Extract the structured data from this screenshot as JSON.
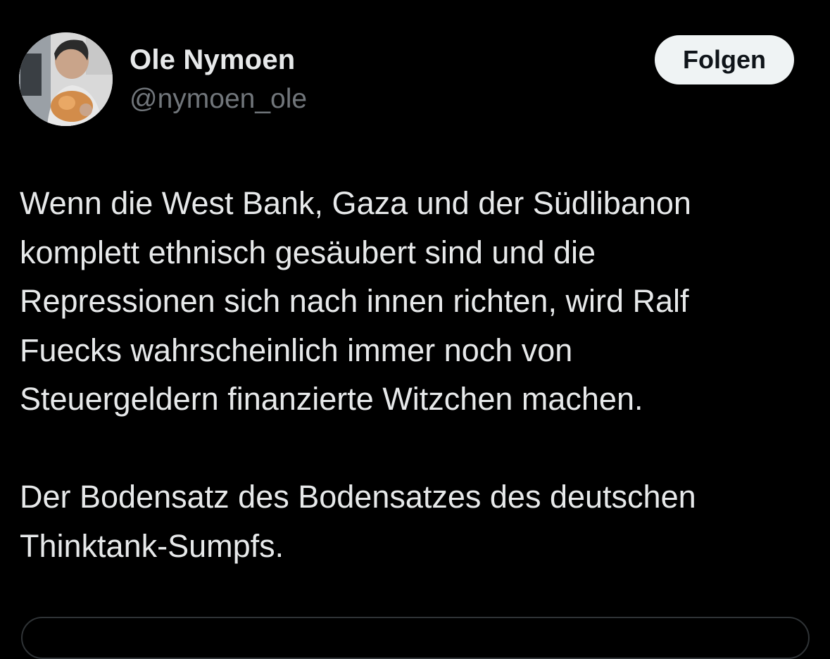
{
  "author": {
    "display_name": "Ole Nymoen",
    "handle": "@nymoen_ole"
  },
  "follow_button": {
    "label": "Folgen"
  },
  "tweet": {
    "paragraph_1": [
      "Wenn die West Bank, Gaza und der Südlibanon",
      "komplett ethnisch gesäubert sind und die",
      "Repressionen sich nach innen richten, wird Ralf",
      "Fuecks wahrscheinlich immer noch von",
      "Steuergeldern finanzierte Witzchen machen."
    ],
    "paragraph_2": [
      "Der Bodensatz des Bodensatzes des deutschen",
      "Thinktank-Sumpfs."
    ]
  },
  "colors": {
    "background": "#000000",
    "primary_text": "#e7e9ea",
    "secondary_text": "#71767b",
    "button_background": "#eff3f4",
    "button_text": "#0f1419",
    "border": "#2f3336"
  }
}
